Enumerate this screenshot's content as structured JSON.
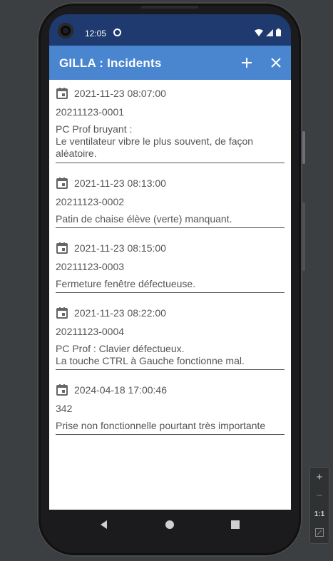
{
  "status_bar": {
    "time": "12:05"
  },
  "app_bar": {
    "title": "GILLA : Incidents",
    "add_icon": "plus-icon",
    "close_icon": "close-icon"
  },
  "incidents": [
    {
      "date": "2021-11-23 08:07:00",
      "number": "20211123-0001",
      "description": "PC Prof bruyant :\nLe ventilateur vibre le plus souvent, de façon aléatoire."
    },
    {
      "date": "2021-11-23 08:13:00",
      "number": "20211123-0002",
      "description": "Patin de chaise élève (verte) manquant."
    },
    {
      "date": "2021-11-23 08:15:00",
      "number": "20211123-0003",
      "description": "Fermeture fenêtre défectueuse."
    },
    {
      "date": "2021-11-23 08:22:00",
      "number": "20211123-0004",
      "description": "PC Prof : Clavier défectueux.\nLa touche CTRL à Gauche fonctionne mal."
    },
    {
      "date": "2024-04-18 17:00:46",
      "number": "342",
      "description": "Prise non fonctionnelle pourtant très importante"
    }
  ],
  "emulator_controls": {
    "zoom_in": "+",
    "zoom_out": "−",
    "one_to_one": "1:1"
  },
  "colors": {
    "status_bar": "#1e3a6e",
    "app_bar": "#4a86d0",
    "text": "#555555"
  }
}
